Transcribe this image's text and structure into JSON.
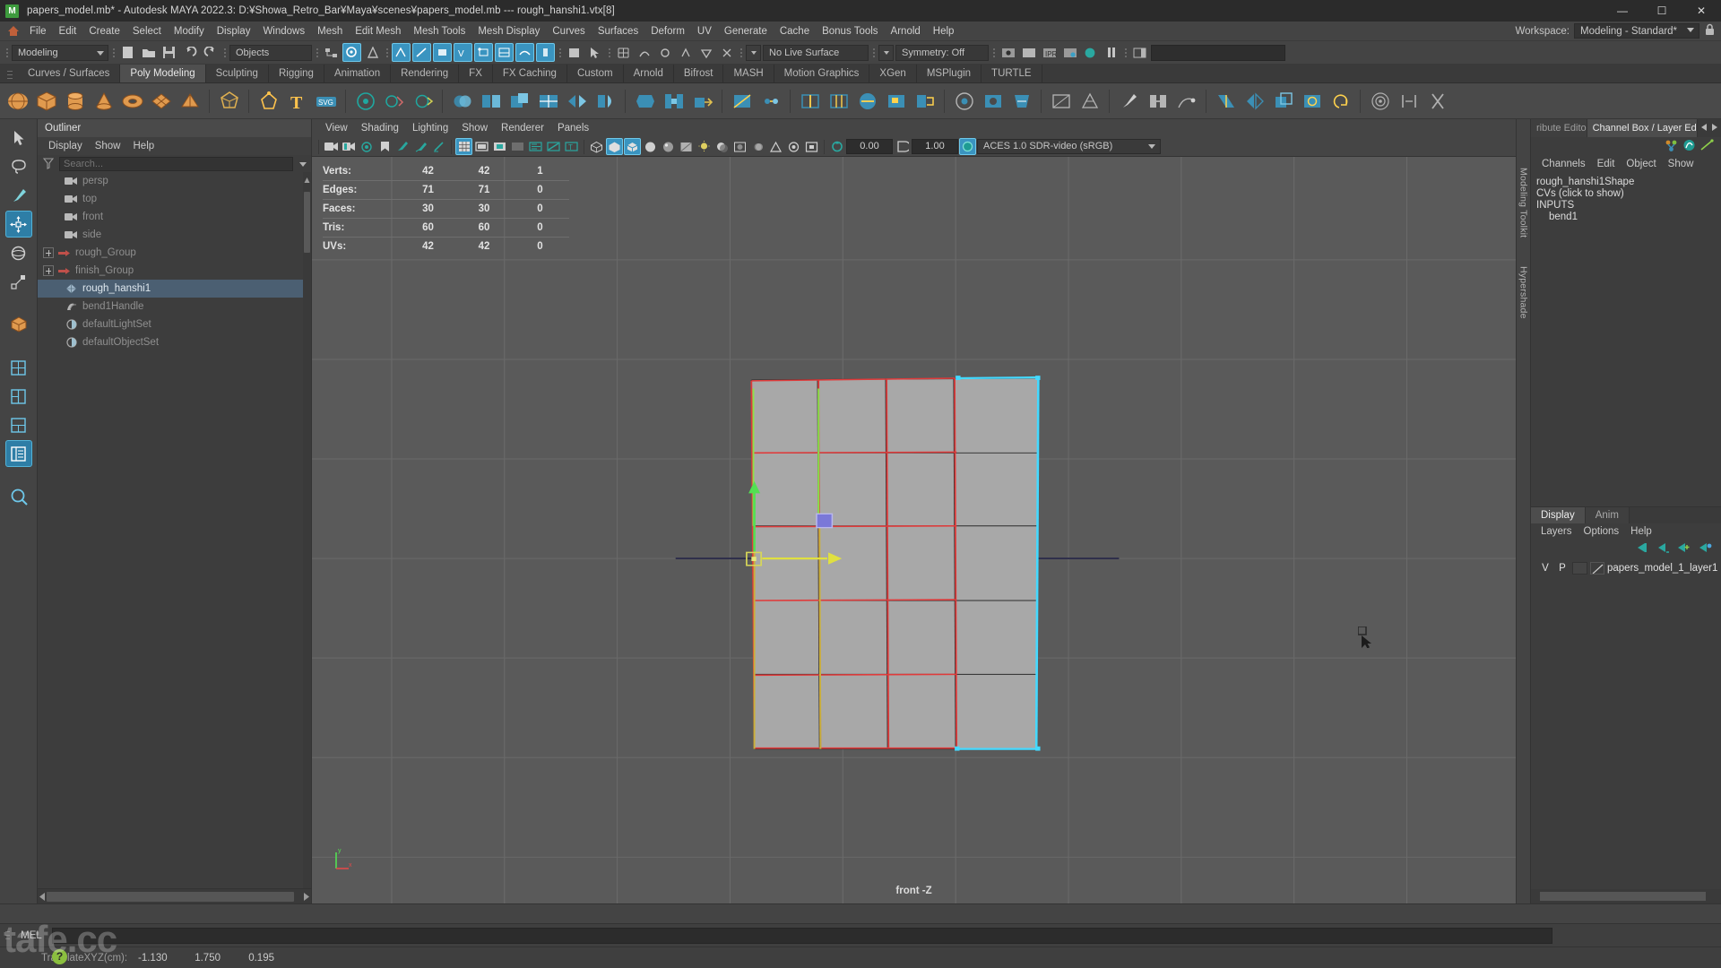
{
  "titlebar": {
    "logo": "M",
    "title": "papers_model.mb* - Autodesk MAYA 2022.3: D:¥Showa_Retro_Bar¥Maya¥scenes¥papers_model.mb  ---  rough_hanshi1.vtx[8]",
    "minimize": "—",
    "maximize": "☐",
    "close": "✕"
  },
  "menubar": {
    "items": [
      "File",
      "Edit",
      "Create",
      "Select",
      "Modify",
      "Display",
      "Windows",
      "Mesh",
      "Edit Mesh",
      "Mesh Tools",
      "Mesh Display",
      "Curves",
      "Surfaces",
      "Deform",
      "UV",
      "Generate",
      "Cache",
      "Bonus Tools",
      "Arnold",
      "Help"
    ],
    "workspace_label": "Workspace:",
    "workspace_value": "Modeling - Standard*"
  },
  "statusline": {
    "mode": "Modeling",
    "object_mode": "Objects",
    "live_surface": "No Live Surface",
    "symmetry": "Symmetry: Off"
  },
  "shelf": {
    "tabs": [
      "Curves / Surfaces",
      "Poly Modeling",
      "Sculpting",
      "Rigging",
      "Animation",
      "Rendering",
      "FX",
      "FX Caching",
      "Custom",
      "Arnold",
      "Bifrost",
      "MASH",
      "Motion Graphics",
      "XGen",
      "MSPlugin",
      "TURTLE"
    ],
    "active_tab": "Poly Modeling"
  },
  "outliner": {
    "title": "Outliner",
    "menu": [
      "Display",
      "Show",
      "Help"
    ],
    "search_placeholder": "Search...",
    "items": [
      {
        "label": "persp",
        "icon": "camera-icon",
        "indent": 1,
        "expandable": false,
        "selected": false
      },
      {
        "label": "top",
        "icon": "camera-icon",
        "indent": 1,
        "expandable": false,
        "selected": false
      },
      {
        "label": "front",
        "icon": "camera-icon",
        "indent": 1,
        "expandable": false,
        "selected": false
      },
      {
        "label": "side",
        "icon": "camera-icon",
        "indent": 1,
        "expandable": false,
        "selected": false
      },
      {
        "label": "rough_Group",
        "icon": "group-icon",
        "indent": 0,
        "expandable": true,
        "selected": false
      },
      {
        "label": "finish_Group",
        "icon": "group-icon",
        "indent": 0,
        "expandable": true,
        "selected": false
      },
      {
        "label": "rough_hanshi1",
        "icon": "mesh-icon",
        "indent": 1,
        "expandable": false,
        "selected": true
      },
      {
        "label": "bend1Handle",
        "icon": "deformer-icon",
        "indent": 1,
        "expandable": false,
        "selected": false
      },
      {
        "label": "defaultLightSet",
        "icon": "set-icon",
        "indent": 1,
        "expandable": false,
        "selected": false
      },
      {
        "label": "defaultObjectSet",
        "icon": "set-icon",
        "indent": 1,
        "expandable": false,
        "selected": false
      }
    ]
  },
  "viewport": {
    "menu": [
      "View",
      "Shading",
      "Lighting",
      "Show",
      "Renderer",
      "Panels"
    ],
    "exposure": "0.00",
    "gamma": "1.00",
    "color_profile": "ACES 1.0 SDR-video (sRGB)",
    "camera_label": "front -Z",
    "hud": {
      "rows": [
        {
          "label": "Verts:",
          "col1": "42",
          "col2": "42",
          "col3": "1"
        },
        {
          "label": "Edges:",
          "col1": "71",
          "col2": "71",
          "col3": "0"
        },
        {
          "label": "Faces:",
          "col1": "30",
          "col2": "30",
          "col3": "0"
        },
        {
          "label": "Tris:",
          "col1": "60",
          "col2": "60",
          "col3": "0"
        },
        {
          "label": "UVs:",
          "col1": "42",
          "col2": "42",
          "col3": "0"
        }
      ]
    },
    "vertical_tabs": [
      "Modeling Toolkit",
      "Hypershade"
    ]
  },
  "channelbox": {
    "tabs": [
      "ribute Editor",
      "Channel Box / Layer Editor"
    ],
    "active_tab": "Channel Box / Layer Editor",
    "menu": [
      "Channels",
      "Edit",
      "Object",
      "Show"
    ],
    "lines": [
      "rough_hanshi1Shape",
      "CVs (click to show)",
      "INPUTS"
    ],
    "input_node": "bend1"
  },
  "layereditor": {
    "tabs": [
      "Display",
      "Anim"
    ],
    "active_tab": "Display",
    "menu": [
      "Layers",
      "Options",
      "Help"
    ],
    "col_v": "V",
    "col_p": "P",
    "layers": [
      {
        "name": "papers_model_1_layer1"
      }
    ]
  },
  "commandline": {
    "mel_label": "MEL",
    "input_value": ""
  },
  "statusbar": {
    "help_glyph": "?",
    "field_label": "TranslateXYZ(cm):",
    "values": [
      "-1.130",
      "1.750",
      "0.195"
    ],
    "watermark": "tafe.cc"
  },
  "colors": {
    "accent_blue": "#3a94c0",
    "selection_cyan": "#44d9ff",
    "selection_red": "#e03b3b",
    "manip_green": "#52e052",
    "manip_yellow": "#e0e040",
    "highlight_row": "#4b5f72",
    "mesh_gray": "#a8a8a8",
    "viewport_bg": "#5a5a5a"
  }
}
